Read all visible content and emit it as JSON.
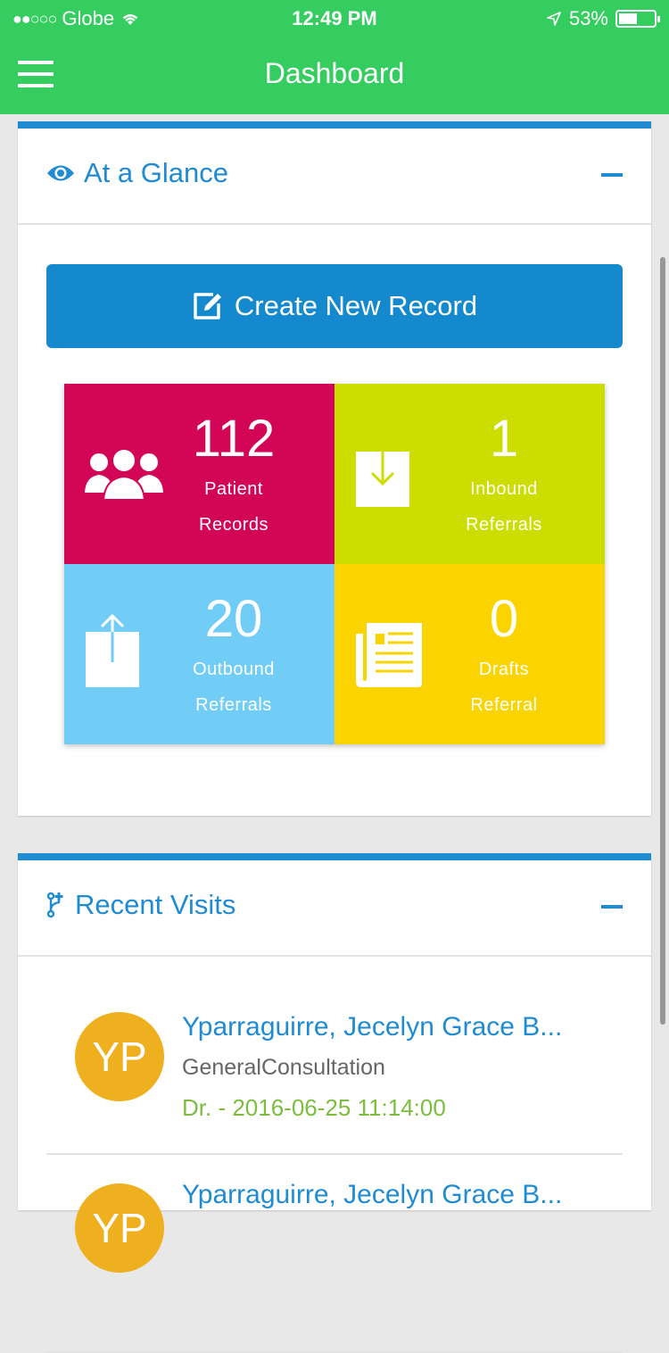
{
  "status": {
    "carrier": "Globe",
    "time": "12:49 PM",
    "battery": "53%",
    "battery_level": 0.53
  },
  "nav": {
    "title": "Dashboard"
  },
  "glance": {
    "title": "At a Glance",
    "create_label": "Create New Record",
    "tiles": [
      {
        "value": "112",
        "line1": "Patient",
        "line2": "Records",
        "color": "#d20557"
      },
      {
        "value": "1",
        "line1": "Inbound",
        "line2": "Referrals",
        "color": "#ccdd00"
      },
      {
        "value": "20",
        "line1": "Outbound",
        "line2": "Referrals",
        "color": "#71cdf5"
      },
      {
        "value": "0",
        "line1": "Drafts",
        "line2": "Referral",
        "color": "#fbd400"
      }
    ]
  },
  "recent": {
    "title": "Recent Visits",
    "items": [
      {
        "initials": "YP",
        "name": "Yparraguirre, Jecelyn Grace B...",
        "type": "GeneralConsultation",
        "date": "Dr. - 2016-06-25 11:14:00"
      },
      {
        "initials": "YP",
        "name": "Yparraguirre, Jecelyn Grace B...",
        "type": "",
        "date": ""
      }
    ]
  },
  "colors": {
    "nav": "#35cd5f",
    "accent": "#1f8bd1",
    "button": "#1589ce",
    "avatar": "#efb01f",
    "date": "#7cbd3e"
  },
  "icons": [
    "menu-icon",
    "wifi-icon",
    "location-arrow-icon",
    "battery-icon",
    "eye-icon",
    "edit-icon",
    "users-icon",
    "inbox-download-icon",
    "upload-icon",
    "newspaper-icon",
    "code-fork-icon"
  ]
}
